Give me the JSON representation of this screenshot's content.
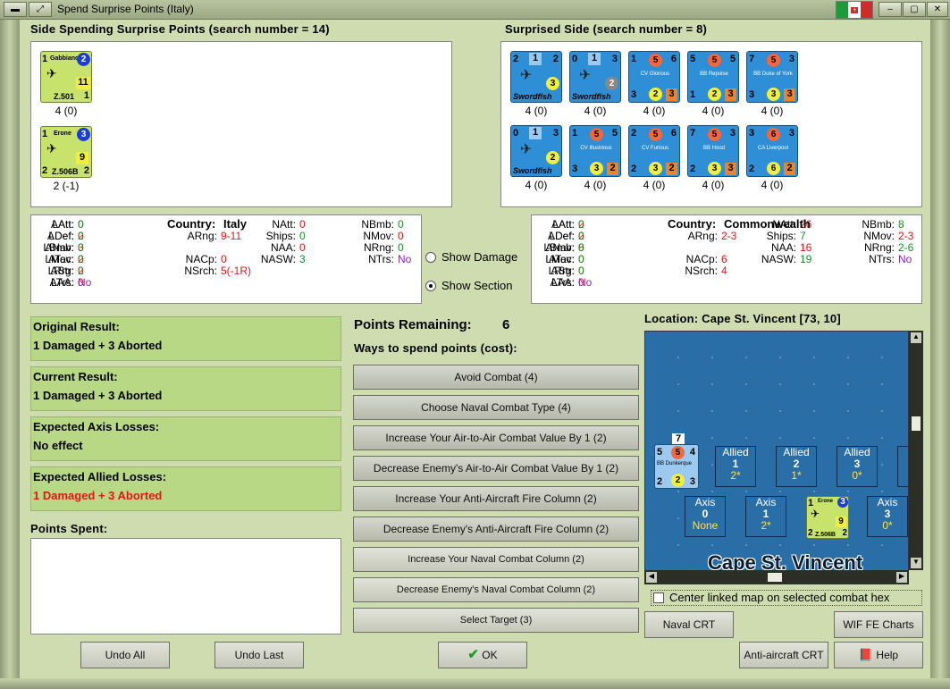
{
  "window": {
    "title": "Spend Surprise Points (Italy)"
  },
  "spending": {
    "header": "Side Spending Surprise Points (search number = 14)",
    "units": [
      {
        "name": "Gabbiano",
        "att": "1",
        "def": "2",
        "val": "11",
        "type": "Z.501",
        "num": "1",
        "caption": "4 (0)"
      },
      {
        "name": "Erone",
        "att": "1",
        "def": "3",
        "val": "9",
        "type": "Z.506B",
        "num": "2",
        "num2": "2",
        "caption": "2 (-1)"
      }
    ]
  },
  "surprised": {
    "header": "Surprised Side (search number = 8)",
    "units": [
      {
        "name": "Swordfish",
        "a": "2",
        "b": "1",
        "c": "2",
        "d": "3",
        "caption": "4 (0)"
      },
      {
        "name": "Swordfish",
        "a": "0",
        "b": "1",
        "c": "3",
        "d": "2",
        "caption": "4 (0)"
      },
      {
        "name": "CV Glorious",
        "a": "1",
        "b": "5",
        "c": "6",
        "d": "3",
        "e": "2",
        "f": "3",
        "caption": "4 (0)"
      },
      {
        "name": "BB Repulse",
        "a": "5",
        "b": "5",
        "c": "5",
        "d": "1",
        "e": "2",
        "f": "3",
        "caption": "4 (0)"
      },
      {
        "name": "BB Duke of York",
        "a": "7",
        "b": "5",
        "c": "3",
        "d": "3",
        "e": "3",
        "f": "3",
        "caption": "4 (0)"
      },
      {
        "name": "Swordfish",
        "a": "0",
        "b": "1",
        "c": "3",
        "d": "2",
        "caption": "4 (0)"
      },
      {
        "name": "CV Illustrious",
        "a": "1",
        "b": "5",
        "c": "5",
        "d": "3",
        "e": "3",
        "f": "2",
        "caption": "4 (0)"
      },
      {
        "name": "CV Furious",
        "a": "2",
        "b": "5",
        "c": "6",
        "d": "2",
        "e": "3",
        "f": "2",
        "caption": "4 (0)"
      },
      {
        "name": "BB Hood",
        "a": "7",
        "b": "5",
        "c": "3",
        "d": "2",
        "e": "3",
        "f": "3",
        "caption": "4 (0)"
      },
      {
        "name": "CA Liverpool",
        "a": "3",
        "b": "6",
        "c": "3",
        "d": "2",
        "e": "6",
        "f": "2",
        "caption": "4 (0)"
      }
    ]
  },
  "stats_left": {
    "country_label": "Country:",
    "country": "Italy",
    "rows": [
      [
        "LAtt:",
        "0",
        "AAtt:",
        "0",
        "NAtt:",
        "0",
        "NBmb:",
        "0"
      ],
      [
        "LDef:",
        "0",
        "ADef:",
        "2",
        "ARng:",
        "9-11",
        "Ships:",
        "0",
        "NMov:",
        "0"
      ],
      [
        "LBmb:",
        "0",
        "ANav:",
        "3",
        "NAA:",
        "0",
        "NRng:",
        "0"
      ],
      [
        "LMov:",
        "0",
        "ATac:",
        "2",
        "NACp:",
        "0",
        "NASW:",
        "3",
        "NTrs:",
        "No"
      ],
      [
        "LRrg:",
        "0",
        "AStr:",
        "2",
        "NSrch:",
        "5(-1R)"
      ],
      [
        "LAA:",
        "0",
        "ATrs:",
        "No"
      ]
    ]
  },
  "stats_right": {
    "country_label": "Country:",
    "country": "Commonwealth",
    "rows": [
      [
        "LAtt:",
        "0",
        "AAtt:",
        "2",
        "NAtt:",
        "26",
        "NBmb:",
        "8"
      ],
      [
        "LDef:",
        "0",
        "ADef:",
        "2",
        "ARng:",
        "2-3",
        "Ships:",
        "7",
        "NMov:",
        "2-3"
      ],
      [
        "LBmb:",
        "0",
        "ANav:",
        "8",
        "NAA:",
        "16",
        "NRng:",
        "2-6"
      ],
      [
        "LMov:",
        "0",
        "ATac:",
        "0",
        "NACp:",
        "6",
        "NASW:",
        "19",
        "NTrs:",
        "No"
      ],
      [
        "LRrg:",
        "0",
        "AStr:",
        "0",
        "NSrch:",
        "4"
      ],
      [
        "LAA:",
        "0",
        "ATrs:",
        "No"
      ]
    ]
  },
  "options": {
    "show_damage": "Show Damage",
    "show_section": "Show Section"
  },
  "results": [
    {
      "label": "Original Result:",
      "value": "1 Damaged + 3 Aborted"
    },
    {
      "label": "Current Result:",
      "value": "1 Damaged + 3 Aborted"
    },
    {
      "label": "Expected Axis Losses:",
      "value": "No effect"
    },
    {
      "label": "Expected Allied Losses:",
      "value": "1 Damaged + 3 Aborted"
    }
  ],
  "points_spent_label": "Points Spent:",
  "points": {
    "label": "Points Remaining:",
    "value": "6",
    "ways": "Ways to spend points (cost):"
  },
  "actions": [
    "Avoid Combat (4)",
    "Choose Naval Combat Type (4)",
    "Increase Your Air-to-Air Combat Value By 1 (2)",
    "Decrease Enemy's Air-to-Air Combat Value By 1 (2)",
    "Increase Your Anti-Aircraft Fire Column (2)",
    "Decrease Enemy's Anti-Aircraft Fire Column (2)",
    "Increase Your Naval Combat Column (2)",
    "Decrease Enemy's Naval Combat Column (2)",
    "Select Target (3)"
  ],
  "location": {
    "label": "Location: Cape St. Vincent [73, 10]",
    "map_name": "Cape St. Vincent"
  },
  "map": {
    "stack_top": "7",
    "ship": {
      "name": "BB Dunkerque",
      "a": "5",
      "b": "5",
      "c": "4",
      "d": "2",
      "e": "2",
      "f": "3"
    },
    "allied": [
      {
        "side": "Allied",
        "num": "1",
        "val": "2*"
      },
      {
        "side": "Allied",
        "num": "2",
        "val": "1*"
      },
      {
        "side": "Allied",
        "num": "3",
        "val": "0*"
      }
    ],
    "axis": [
      {
        "side": "Axis",
        "num": "0",
        "val": "None"
      },
      {
        "side": "Axis",
        "num": "1",
        "val": "2*"
      },
      {
        "side": "Axis",
        "num": "3",
        "val": "0*"
      }
    ],
    "erone": {
      "name": "Erone",
      "att": "1",
      "def": "3",
      "val": "9",
      "type": "Z.506B",
      "num": "2",
      "num2": "2"
    }
  },
  "center_linked": "Center linked map on selected combat hex",
  "buttons": {
    "naval_crt": "Naval CRT",
    "wif_fe": "WIF FE Charts",
    "aa_crt": "Anti-aircraft CRT",
    "help": "Help",
    "undo_all": "Undo All",
    "undo_last": "Undo Last",
    "ok": "OK"
  }
}
